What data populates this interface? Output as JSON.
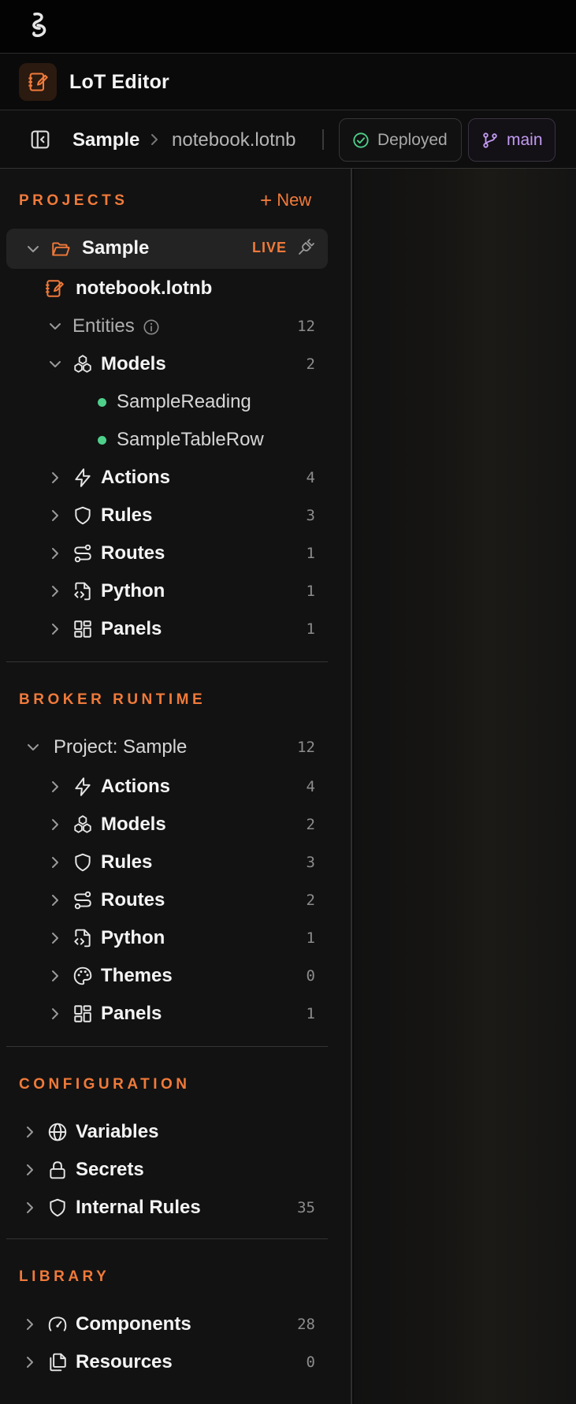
{
  "app": {
    "title": "LoT Editor"
  },
  "breadcrumb": {
    "project": "Sample",
    "file": "notebook.lotnb"
  },
  "status": {
    "deploy_label": "Deployed",
    "branch_label": "main"
  },
  "colors": {
    "accent": "#f07a3a",
    "success": "#4ed08b",
    "branch": "#c29af2"
  },
  "projects": {
    "title": "PROJECTS",
    "new_label": "New",
    "project_name": "Sample",
    "live_label": "LIVE",
    "notebook": "notebook.lotnb",
    "entities": {
      "label": "Entities",
      "count": "12"
    },
    "models": {
      "label": "Models",
      "count": "2",
      "children": [
        "SampleReading",
        "SampleTableRow"
      ]
    },
    "items": [
      {
        "label": "Actions",
        "count": "4",
        "icon": "lightning-icon"
      },
      {
        "label": "Rules",
        "count": "3",
        "icon": "shield-icon"
      },
      {
        "label": "Routes",
        "count": "1",
        "icon": "route-icon"
      },
      {
        "label": "Python",
        "count": "1",
        "icon": "code-file-icon"
      },
      {
        "label": "Panels",
        "count": "1",
        "icon": "panels-icon"
      }
    ]
  },
  "broker": {
    "title": "BROKER RUNTIME",
    "project_label": "Project: Sample",
    "project_count": "12",
    "items": [
      {
        "label": "Actions",
        "count": "4",
        "icon": "lightning-icon"
      },
      {
        "label": "Models",
        "count": "2",
        "icon": "cubes-icon"
      },
      {
        "label": "Rules",
        "count": "3",
        "icon": "shield-icon"
      },
      {
        "label": "Routes",
        "count": "2",
        "icon": "route-icon"
      },
      {
        "label": "Python",
        "count": "1",
        "icon": "code-file-icon"
      },
      {
        "label": "Themes",
        "count": "0",
        "icon": "palette-icon"
      },
      {
        "label": "Panels",
        "count": "1",
        "icon": "panels-icon"
      }
    ]
  },
  "configuration": {
    "title": "CONFIGURATION",
    "items": [
      {
        "label": "Variables",
        "count": "",
        "icon": "globe-icon"
      },
      {
        "label": "Secrets",
        "count": "",
        "icon": "lock-icon"
      },
      {
        "label": "Internal Rules",
        "count": "35",
        "icon": "shield-icon"
      }
    ]
  },
  "library": {
    "title": "LIBRARY",
    "items": [
      {
        "label": "Components",
        "count": "28",
        "icon": "gauge-icon"
      },
      {
        "label": "Resources",
        "count": "0",
        "icon": "files-icon"
      }
    ]
  }
}
